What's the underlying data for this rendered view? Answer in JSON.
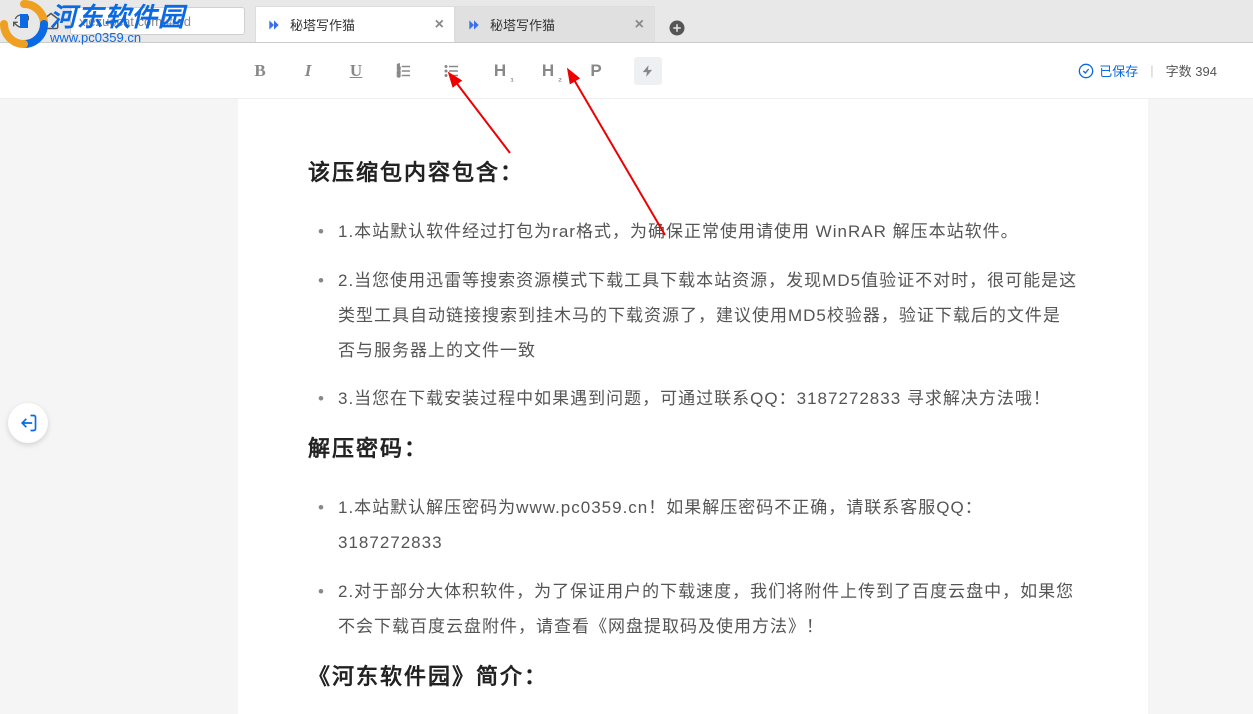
{
  "browser": {
    "url": "xiezuocat.com/#/ed",
    "tabs": [
      {
        "title": "秘塔写作猫",
        "active": true
      },
      {
        "title": "秘塔写作猫",
        "active": false
      }
    ]
  },
  "toolbar": {
    "bold": "B",
    "italic": "I",
    "underline": "U",
    "ordered": "≡",
    "unordered": "≡",
    "h1": "H",
    "h2": "H",
    "p": "P",
    "flash": "⚡"
  },
  "status": {
    "saved": "已保存",
    "word_label": "字数",
    "word_count": "394"
  },
  "document": {
    "section1_title": "该压缩包内容包含：",
    "section1_items": [
      "1.本站默认软件经过打包为rar格式，为确保正常使用请使用 WinRAR 解压本站软件。",
      "2.当您使用迅雷等搜索资源模式下载工具下载本站资源，发现MD5值验证不对时，很可能是这类型工具自动链接搜索到挂木马的下载资源了，建议使用MD5校验器，验证下载后的文件是否与服务器上的文件一致",
      "3.当您在下载安装过程中如果遇到问题，可通过联系QQ：3187272833 寻求解决方法哦！"
    ],
    "section2_title": "解压密码：",
    "section2_items": [
      "1.本站默认解压密码为www.pc0359.cn！如果解压密码不正确，请联系客服QQ：3187272833",
      "2.对于部分大体积软件，为了保证用户的下载速度，我们将附件上传到了百度云盘中，如果您不会下载百度云盘附件，请查看《网盘提取码及使用方法》！"
    ],
    "section3_title": "《河东软件园》简介："
  },
  "watermark": {
    "cn": "河东软件园",
    "url": "www.pc0359.cn"
  }
}
